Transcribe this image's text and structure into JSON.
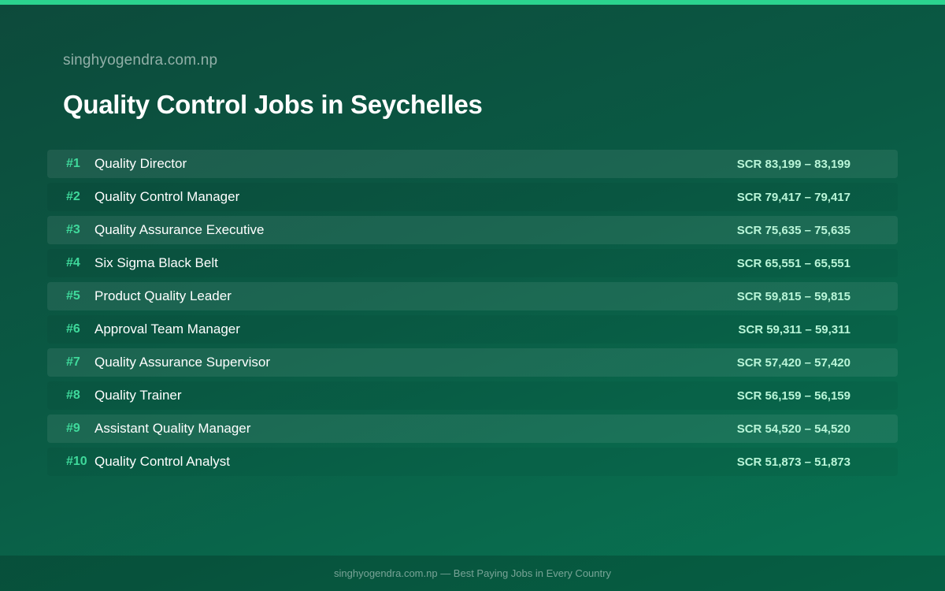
{
  "site": {
    "name": "singhyogendra.com.np"
  },
  "header": {
    "title": "Quality Control Jobs in Seychelles"
  },
  "jobs": [
    {
      "rank": "#1",
      "title": "Quality Director",
      "salary": "SCR 83,199 – 83,199"
    },
    {
      "rank": "#2",
      "title": "Quality Control Manager",
      "salary": "SCR 79,417 – 79,417"
    },
    {
      "rank": "#3",
      "title": "Quality Assurance Executive",
      "salary": "SCR 75,635 – 75,635"
    },
    {
      "rank": "#4",
      "title": "Six Sigma Black Belt",
      "salary": "SCR 65,551 – 65,551"
    },
    {
      "rank": "#5",
      "title": "Product Quality Leader",
      "salary": "SCR 59,815 – 59,815"
    },
    {
      "rank": "#6",
      "title": "Approval Team Manager",
      "salary": "SCR 59,311 – 59,311"
    },
    {
      "rank": "#7",
      "title": "Quality Assurance Supervisor",
      "salary": "SCR 57,420 – 57,420"
    },
    {
      "rank": "#8",
      "title": "Quality Trainer",
      "salary": "SCR 56,159 – 56,159"
    },
    {
      "rank": "#9",
      "title": "Assistant Quality Manager",
      "salary": "SCR 54,520 – 54,520"
    },
    {
      "rank": "#10",
      "title": "Quality Control Analyst",
      "salary": "SCR 51,873 – 51,873"
    }
  ],
  "footer": {
    "text": "singhyogendra.com.np — Best Paying Jobs in Every Country"
  },
  "colors": {
    "accent": "#2bd38e",
    "rank": "#3fd99b",
    "salary": "#b9f5d8",
    "background_start": "#0d4a3b",
    "background_end": "#087553"
  }
}
